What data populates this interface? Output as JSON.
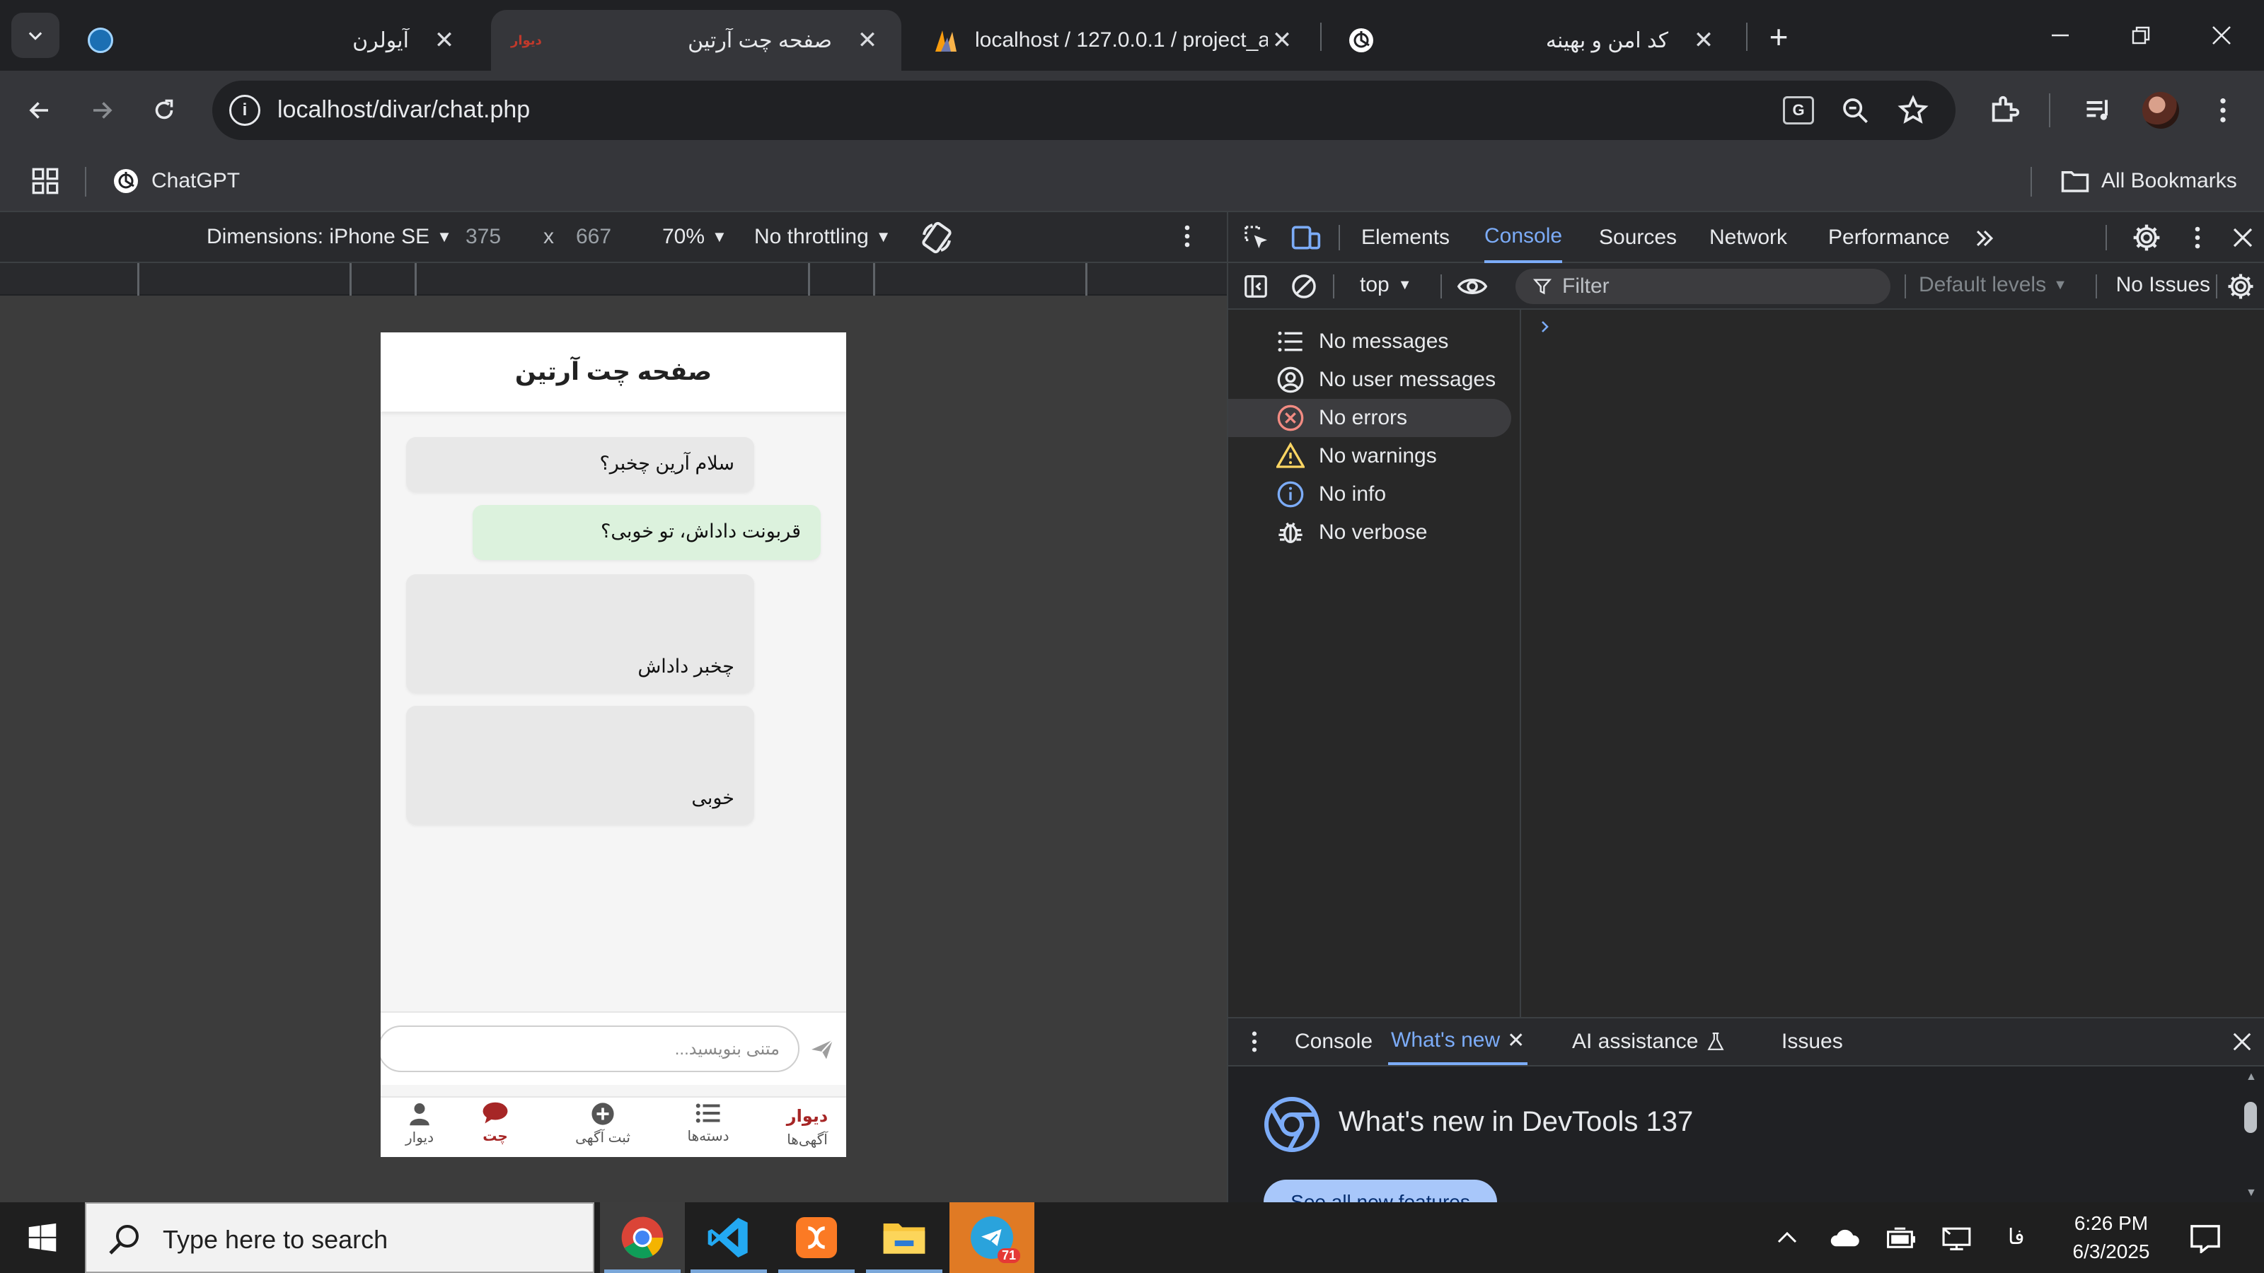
{
  "browser": {
    "tabs": [
      {
        "title": "آیولرن"
      },
      {
        "title": "صفحه چت آرتین"
      },
      {
        "title": "localhost / 127.0.0.1 / project_a"
      },
      {
        "title": "کد امن و بهینه"
      }
    ],
    "url": "localhost/divar/chat.php",
    "bookmarks": {
      "chatgpt": "ChatGPT",
      "all": "All Bookmarks"
    }
  },
  "device_toolbar": {
    "dimensions": "Dimensions: iPhone SE",
    "width": "375",
    "times": "x",
    "height": "667",
    "zoom": "70%",
    "throttling": "No throttling"
  },
  "chat": {
    "header_title": "صفحه چت آرتین",
    "messages": [
      {
        "text": "سلام آرین چخبر؟",
        "side": "them"
      },
      {
        "text": "قربونت داداش، تو خوبی؟",
        "side": "me"
      },
      {
        "text": "چخبر داداش",
        "side": "them"
      },
      {
        "text": "خوبی",
        "side": "them"
      }
    ],
    "input_placeholder": "متنی بنویسید...",
    "nav": {
      "ads_brand": "دیوار",
      "ads": "آگهی‌ها",
      "categories": "دسته‌ها",
      "post_ad": "ثبت آگهی",
      "chat": "چت",
      "my_divar": "دیوار"
    }
  },
  "devtools": {
    "tabs": {
      "elements": "Elements",
      "console": "Console",
      "sources": "Sources",
      "network": "Network",
      "performance": "Performance"
    },
    "context": "top",
    "filter_placeholder": "Filter",
    "levels": "Default levels",
    "issues": "No Issues",
    "sidebar": {
      "messages": "No messages",
      "user_messages": "No user messages",
      "errors": "No errors",
      "warnings": "No warnings",
      "info": "No info",
      "verbose": "No verbose"
    },
    "drawer": {
      "console": "Console",
      "whats_new": "What's new",
      "ai": "AI assistance",
      "issues": "Issues",
      "headline": "What's new in DevTools 137",
      "see_all": "See all new features"
    }
  },
  "taskbar": {
    "search_placeholder": "Type here to search",
    "telegram_badge": "71",
    "lang": "فا",
    "time": "6:26 PM",
    "date": "6/3/2025"
  },
  "colors": {
    "accent_blue": "#7cacf8",
    "divar_red": "#a62626",
    "bubble_green": "#dcf2dd",
    "bubble_gray": "#e8e8e8"
  }
}
